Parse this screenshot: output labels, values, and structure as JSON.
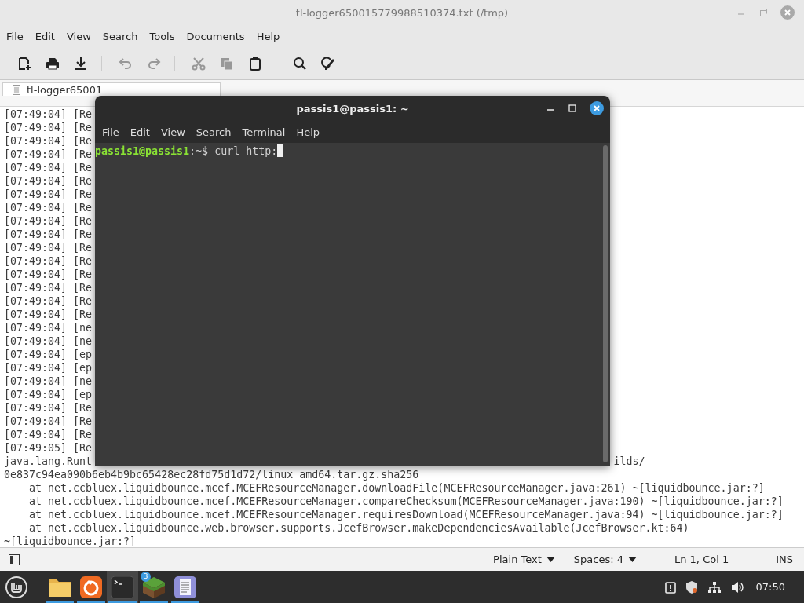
{
  "window": {
    "title": "tl-logger650015779988510374.txt (/tmp)"
  },
  "menu": [
    "File",
    "Edit",
    "View",
    "Search",
    "Tools",
    "Documents",
    "Help"
  ],
  "toolbar": [
    {
      "items": [
        {
          "kind": "new",
          "disabled": false
        },
        {
          "kind": "print",
          "disabled": false
        },
        {
          "kind": "save",
          "disabled": false
        }
      ]
    },
    {
      "items": [
        {
          "kind": "undo",
          "disabled": true
        },
        {
          "kind": "redo",
          "disabled": true
        }
      ]
    },
    {
      "items": [
        {
          "kind": "cut",
          "disabled": true
        },
        {
          "kind": "copy",
          "disabled": true
        },
        {
          "kind": "paste",
          "disabled": false
        }
      ]
    },
    {
      "items": [
        {
          "kind": "search",
          "disabled": false
        },
        {
          "kind": "replace",
          "disabled": false
        }
      ]
    }
  ],
  "tab": {
    "label": "tl-logger65001"
  },
  "editor_lines": [
    {
      "text": "[07:49:04] [Re"
    },
    {
      "text": "[07:49:04] [Re"
    },
    {
      "text": "[07:49:04] [Re"
    },
    {
      "text": "[07:49:04] [Re"
    },
    {
      "text": "[07:49:04] [Re"
    },
    {
      "text": "[07:49:04] [Re"
    },
    {
      "text": "[07:49:04] [Re"
    },
    {
      "text": "[07:49:04] [Re"
    },
    {
      "text": "[07:49:04] [Re"
    },
    {
      "text": "[07:49:04] [Re"
    },
    {
      "text": "[07:49:04] [Re"
    },
    {
      "text": "[07:49:04] [Re"
    },
    {
      "text": "[07:49:04] [Re"
    },
    {
      "text": "[07:49:04] [Re"
    },
    {
      "text": "[07:49:04] [Re"
    },
    {
      "text": "[07:49:04] [Re"
    },
    {
      "text": "[07:49:04] [ne"
    },
    {
      "text": "[07:49:04] [ne"
    },
    {
      "text": "[07:49:04] [ep"
    },
    {
      "text": "[07:49:04] [ep"
    },
    {
      "text": "[07:49:04] [ne"
    },
    {
      "text": "[07:49:04] [ep"
    },
    {
      "text": "[07:49:04] [Re"
    },
    {
      "text": "[07:49:04] [Re"
    },
    {
      "text": "[07:49:04] [Re"
    },
    {
      "text": "[07:49:05] [Re"
    },
    {
      "text": "java.lang.Runt",
      "tail": "ilds/"
    },
    {
      "text": "0e837c94ea090b6eb4b9bc65428ec28fd75d1d72/linux_amd64.tar.gz.sha256"
    },
    {
      "text": "    at net.ccbluex.liquidbounce.mcef.MCEFResourceManager.downloadFile(MCEFResourceManager.java:261) ~[liquidbounce.jar:?]"
    },
    {
      "text": "    at net.ccbluex.liquidbounce.mcef.MCEFResourceManager.compareChecksum(MCEFResourceManager.java:190) ~[liquidbounce.jar:?]"
    },
    {
      "text": "    at net.ccbluex.liquidbounce.mcef.MCEFResourceManager.requiresDownload(MCEFResourceManager.java:94) ~[liquidbounce.jar:?]"
    },
    {
      "text": "    at net.ccbluex.liquidbounce.web.browser.supports.JcefBrowser.makeDependenciesAvailable(JcefBrowser.kt:64)"
    },
    {
      "text": "~[liquidbounce.jar:?]"
    }
  ],
  "status_bar": {
    "language": "Plain Text",
    "indent": "Spaces: 4",
    "position": "Ln 1, Col 1",
    "mode": "INS"
  },
  "terminal": {
    "title": "passis1@passis1: ~",
    "menu": [
      "File",
      "Edit",
      "View",
      "Search",
      "Terminal",
      "Help"
    ],
    "prompt_user": "passis1@passis1",
    "prompt_path": ":~$",
    "command": "curl http:"
  },
  "taskbar": {
    "apps": [
      {
        "kind": "files",
        "selected": false
      },
      {
        "kind": "browser",
        "selected": false
      },
      {
        "kind": "terminal",
        "selected": true
      },
      {
        "kind": "game",
        "selected": false,
        "badge": "3"
      },
      {
        "kind": "editor",
        "selected": false
      }
    ],
    "clock": "07:50"
  }
}
